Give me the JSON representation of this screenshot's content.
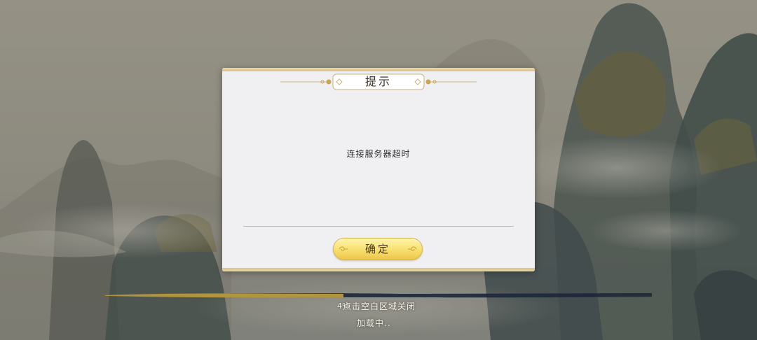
{
  "dialog": {
    "title": "提示",
    "message": "连接服务器超时",
    "confirm_label": "确定"
  },
  "overlay": {
    "tap_to_close_hint": "点击空白区域关闭"
  },
  "loading": {
    "progress_text": "4%",
    "status_text": "加载中.."
  },
  "colors": {
    "dialog_background": "#f0eff2",
    "dialog_gold_band": "#e3cf97",
    "button_gold": "#f7df6e",
    "loadbar_gold": "#b89a3e",
    "loadbar_track": "#1d2738"
  },
  "icons": {
    "title_ornament": "cloud-scroll-ornament",
    "button_decoration": "cloud-swirl-icon"
  }
}
